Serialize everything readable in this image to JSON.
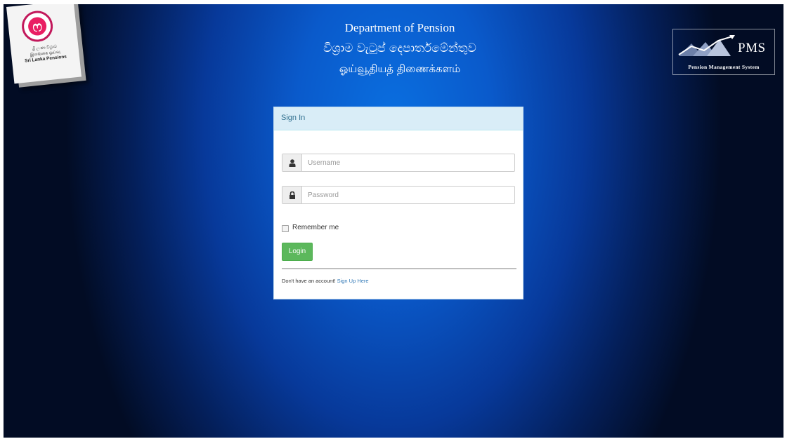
{
  "logo": {
    "emblem_glyph": "ෆ",
    "line1": "ශ්‍රී ලංකා විශ්‍රාම",
    "line2": "இலங்கை ஓய்வு",
    "line3": "Sri Lanka Pensions"
  },
  "header": {
    "english": "Department of Pension",
    "sinhala": "විශ්‍රාම වැටුප් දෙපාර්තමේන්තුව",
    "tamil": "ஓய்வூதியத் திணைக்களம்"
  },
  "pms_logo": {
    "title": "PMS",
    "subtitle": "Pension Management System"
  },
  "signin": {
    "heading": "Sign In",
    "username_placeholder": "Username",
    "password_placeholder": "Password",
    "username_icon": "user-icon",
    "password_icon": "lock-icon",
    "remember_label": "Remember me",
    "remember_checked": false,
    "login_label": "Login",
    "no_account_text": "Don't have an account!",
    "signup_link": "Sign Up Here"
  },
  "colors": {
    "panel_heading_bg": "#d9edf7",
    "login_button": "#5cb85c",
    "link": "#337ab7",
    "background_center": "#0a6fe0",
    "background_edge": "#020c24"
  }
}
